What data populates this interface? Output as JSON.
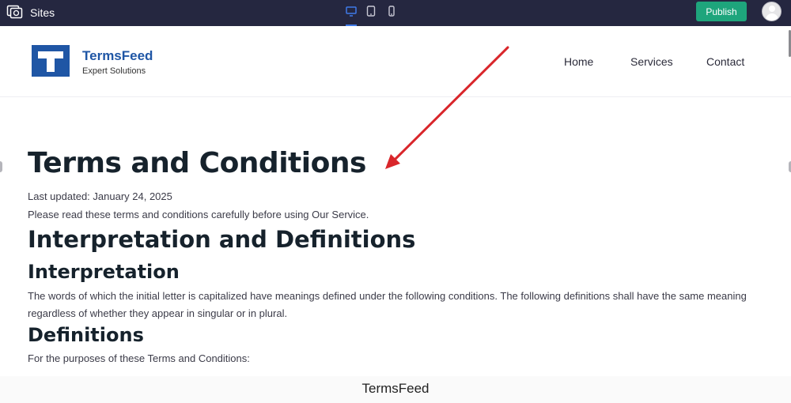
{
  "editor": {
    "sites_label": "Sites",
    "publish_label": "Publish",
    "colors": {
      "bar": "#252740",
      "publish": "#1ea57c",
      "active_device": "#3f7ae8"
    },
    "devices": [
      "desktop-icon",
      "tablet-icon",
      "mobile-icon"
    ]
  },
  "site": {
    "brand_name": "TermsFeed",
    "brand_tagline": "Expert Solutions",
    "brand_color": "#1f56a5",
    "nav": [
      "Home",
      "Services",
      "Contact"
    ]
  },
  "content": {
    "title": "Terms and Conditions",
    "last_updated": "Last updated: January 24, 2025",
    "intro": "Please read these terms and conditions carefully before using Our Service.",
    "section_heading": "Interpretation and Definitions",
    "interpretation_heading": "Interpretation",
    "interpretation_text": "The words of which the initial letter is capitalized have meanings defined under the following conditions. The following definitions shall have the same meaning regardless of whether they appear in singular or in plural.",
    "definitions_heading": "Definitions",
    "definitions_text": "For the purposes of these Terms and Conditions:"
  },
  "annotation": {
    "color": "#d9262b"
  },
  "watermark": "TermsFeed"
}
